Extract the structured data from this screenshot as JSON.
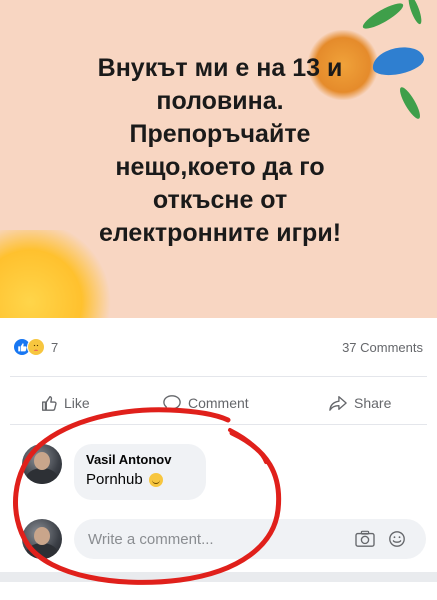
{
  "post": {
    "text": "Внукът ми е на 13 и\nполовина.\nПрепоръчайте\nнещо,което да го\nоткъсне от\nелектронните игри!"
  },
  "stats": {
    "reactions_count": "7",
    "comments_count": "37 Comments"
  },
  "actions": {
    "like_label": "Like",
    "comment_label": "Comment",
    "share_label": "Share"
  },
  "comment": {
    "author": "Vasil Antonov",
    "text": "Pornhub"
  },
  "composer": {
    "placeholder": "Write a comment..."
  },
  "colors": {
    "post_background": "#f8d6c2",
    "facebook_blue": "#1877f2",
    "annotation_red": "#e0201b"
  },
  "icons": [
    "like-reaction-icon",
    "care-reaction-icon",
    "like-icon",
    "comment-icon",
    "share-icon",
    "smile-emoji-icon",
    "camera-icon",
    "emoji-icon"
  ]
}
